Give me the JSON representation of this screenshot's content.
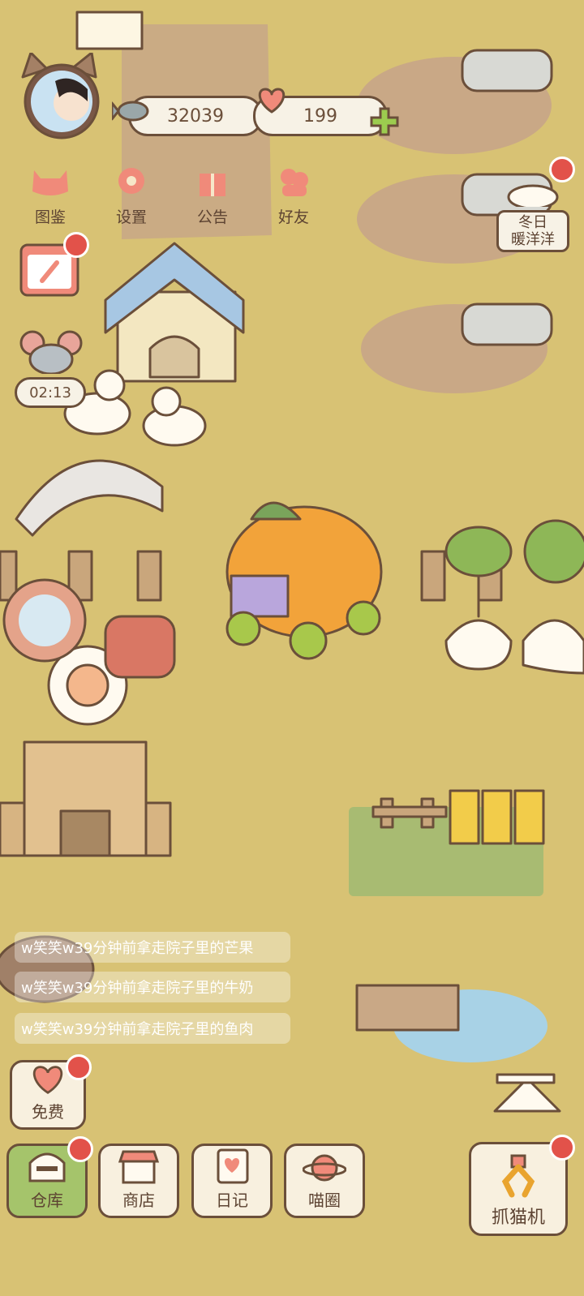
{
  "currency": {
    "fish_amount": "32039",
    "heart_amount": "199"
  },
  "menu": [
    {
      "label": "图鉴",
      "icon": "cat-face-icon"
    },
    {
      "label": "设置",
      "icon": "gear-icon"
    },
    {
      "label": "公告",
      "icon": "gift-icon"
    },
    {
      "label": "好友",
      "icon": "friends-icon"
    }
  ],
  "event": {
    "label_line1": "冬日",
    "label_line2": "暖洋洋"
  },
  "timer": {
    "value": "02:13"
  },
  "feed": [
    "w笑笑w39分钟前拿走院子里的芒果",
    "w笑笑w39分钟前拿走院子里的牛奶",
    "w笑笑w39分钟前拿走院子里的鱼肉"
  ],
  "bottom": {
    "free": "免费",
    "warehouse": "仓库",
    "shop": "商店",
    "diary": "日记",
    "circle": "喵圈",
    "claw": "抓猫机"
  },
  "colors": {
    "ground": "#d8c274",
    "outline": "#6b4f3a",
    "badge": "#e2524a",
    "accent": "#f08a7a"
  }
}
